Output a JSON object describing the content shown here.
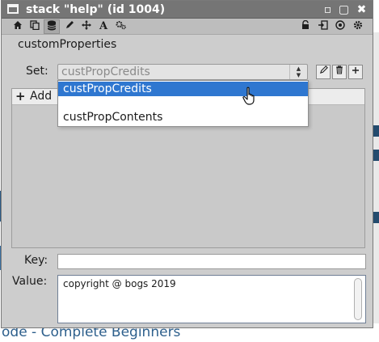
{
  "window": {
    "title": "stack \"help\" (id 1004)",
    "controls": [
      "restore-icon",
      "maximize-icon",
      "close-icon"
    ]
  },
  "toolbar": {
    "left_tools": [
      "home-icon",
      "copy-icon",
      "database-icon",
      "pencil-icon",
      "move-icon",
      "text-icon",
      "gears-icon"
    ],
    "right_tools": [
      "lock-icon",
      "import-icon",
      "target-icon",
      "gear-icon"
    ],
    "active_tool": "database-icon"
  },
  "inspector": {
    "section_title": "customProperties",
    "set_label": "Set:",
    "set_value": "custPropCredits",
    "set_buttons": [
      "edit-icon",
      "trash-icon",
      "add-icon"
    ],
    "add_label": "Add",
    "key_label": "Key:",
    "key_value": "",
    "value_label": "Value:",
    "value_text": "copyright @ bogs 2019"
  },
  "dropdown": {
    "options": [
      "custPropCredits",
      "custPropContents"
    ],
    "highlighted": "custPropCredits"
  },
  "background": {
    "visible_text": "ode - Complete Beginners"
  },
  "colors": {
    "titlebar": "#757575",
    "highlight": "#2f77d0",
    "panel": "#cdcdcd"
  }
}
